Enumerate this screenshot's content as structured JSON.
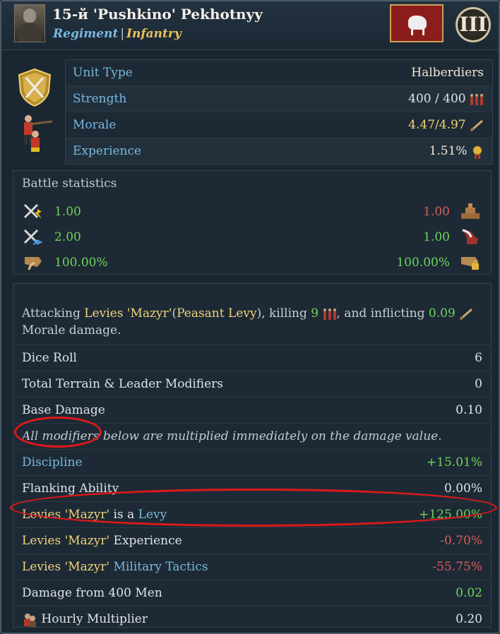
{
  "header": {
    "title": "15-й 'Pushkino' Pekhotnyy",
    "type": "Regiment",
    "separator": "|",
    "category": "Infantry",
    "rank": "III"
  },
  "info": {
    "rows": [
      {
        "label": "Unit Type",
        "value": "Halberdiers"
      },
      {
        "label": "Strength",
        "value": "400 / 400",
        "icon": "men-icon"
      },
      {
        "label": "Morale",
        "value": "4.47/4.97",
        "icon": "morale-icon"
      },
      {
        "label": "Experience",
        "value": "1.51%",
        "icon": "medal-icon"
      }
    ]
  },
  "battle": {
    "heading": "Battle statistics",
    "rows": [
      {
        "left": "1.00",
        "right": "1.00",
        "left_icon": "fire-attack-icon",
        "right_icon": "fortification-icon",
        "right_color": "#d95c5c"
      },
      {
        "left": "2.00",
        "right": "1.00",
        "left_icon": "shock-attack-icon",
        "right_icon": "maneuver-icon",
        "right_color": "#6fd45a"
      },
      {
        "left": "100.00%",
        "right": "100.00%",
        "left_icon": "recovery-icon",
        "right_icon": "reserve-icon",
        "right_color": "#6fd45a"
      }
    ]
  },
  "attack": {
    "p1": "Attacking ",
    "target": "Levies 'Mazyr'",
    "target_type_open": "(",
    "target_type": "Peasant Levy",
    "target_type_close": ")",
    "p2": ", killing ",
    "kills": "9",
    "p3": ", and inflicting ",
    "morale_damage": "0.09",
    "p4": " Morale damage.",
    "rows": [
      {
        "label": "Dice Roll",
        "value": "6"
      },
      {
        "label": "Total Terrain & Leader Modifiers",
        "value": "0"
      },
      {
        "label": "Base Damage",
        "value": "0.10"
      },
      {
        "label": "All modifiers below are multiplied immediately on the damage value.",
        "value": ""
      },
      {
        "label": "Discipline",
        "value": "+15.01%"
      },
      {
        "label": "Flanking Ability",
        "value": "0.00%"
      },
      {
        "label_a": "Levies 'Mazyr'",
        "label_b": " is a ",
        "label_c": "Levy",
        "value": "+125.00%"
      },
      {
        "label_a": "Levies 'Mazyr'",
        "label_b": " Experience",
        "value": "-0.70%"
      },
      {
        "label_a": "Levies 'Mazyr'",
        "label_b": " ",
        "label_c": "Military Tactics",
        "value": "-55.75%"
      },
      {
        "label": "Damage from 400 Men",
        "value": "0.02"
      },
      {
        "label": "Hourly Multiplier",
        "value": "0.20"
      }
    ]
  },
  "colors": {
    "positive": "#6fd45a",
    "negative": "#d95c5c",
    "link": "#79b8e0",
    "highlight": "#f2d377",
    "annotation": "#e01818"
  }
}
